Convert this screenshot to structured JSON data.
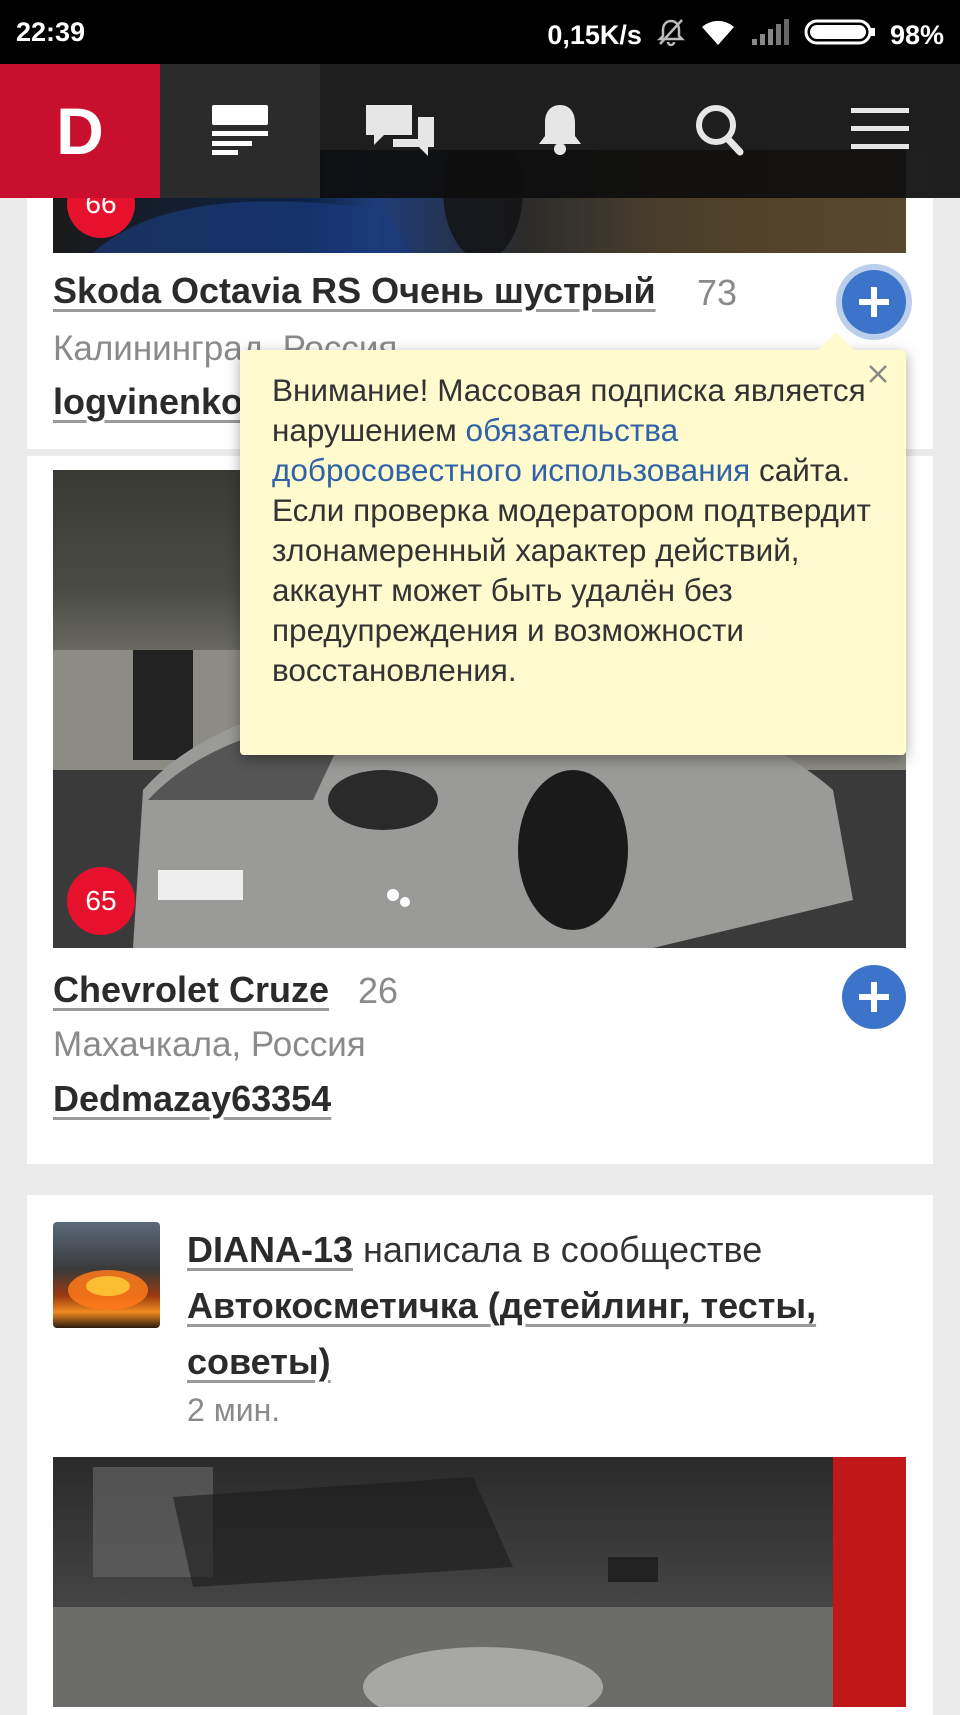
{
  "status_bar": {
    "time": "22:39",
    "network_speed": "0,15K/s",
    "battery": "98%",
    "icons": [
      "bell-muted-icon",
      "wifi-icon",
      "signal-icon",
      "battery-icon"
    ]
  },
  "nav": {
    "logo": "D",
    "items": [
      "feed-icon",
      "messages-icon",
      "notifications-icon",
      "search-icon",
      "menu-icon"
    ],
    "active_item": "feed-icon"
  },
  "cards": [
    {
      "badge": "66",
      "title": "Skoda Octavia RS Очень шустрый",
      "count": "73",
      "location": "Калининград, Россия",
      "owner": "logvinenko"
    },
    {
      "badge": "65",
      "title": "Chevrolet Cruze",
      "count": "26",
      "location": "Махачкала, Россия",
      "owner": "Dedmazay63354"
    }
  ],
  "tooltip": {
    "text_before": "Внимание! Массовая подписка является нарушением ",
    "link": "обязательства добросовестного использования",
    "text_after": " сайта. Если проверка модератором подтвердит злонамеренный характер действий, аккаунт может быть удалён без предупреждения и возможности восстановления."
  },
  "post": {
    "author": "DIANA-13",
    "action": " написала в сообществе ",
    "community": "Автокосметичка (детейлинг, тесты, советы)",
    "time": "2 мин."
  },
  "colors": {
    "brand": "#c8102e",
    "badge": "#e8112d",
    "plus_button": "#3b74c9",
    "tooltip_bg": "#fffbcf",
    "link": "#2f62a8"
  }
}
